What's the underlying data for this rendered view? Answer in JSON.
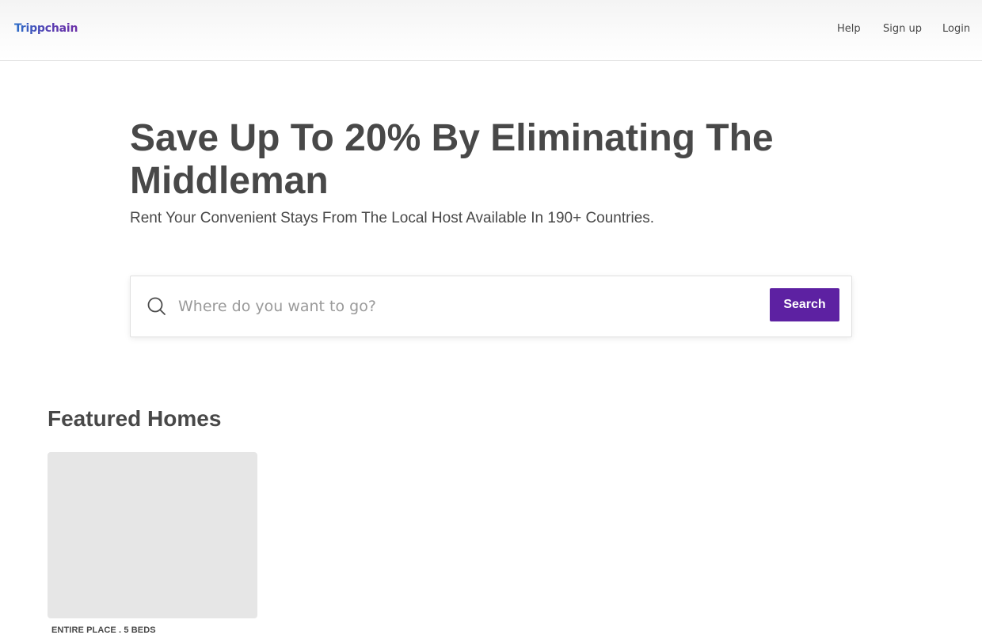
{
  "header": {
    "logo_text": "Trippchain",
    "nav": {
      "help": "Help",
      "signup": "Sign up",
      "login": "Login"
    }
  },
  "hero": {
    "title": "Save Up To 20% By Eliminating The Middleman",
    "subtitle": "Rent Your Convenient Stays From The Local Host Available In 190+ Countries."
  },
  "search": {
    "placeholder": "Where do you want to go?",
    "value": "",
    "button_label": "Search",
    "icon": "search-icon"
  },
  "featured": {
    "title": "Featured Homes",
    "cards": [
      {
        "meta": "ENTIRE PLACE . 5 BEDS"
      }
    ]
  },
  "colors": {
    "accent": "#5d21a2",
    "text": "#484848",
    "placeholder_bg": "#e6e6e6"
  }
}
